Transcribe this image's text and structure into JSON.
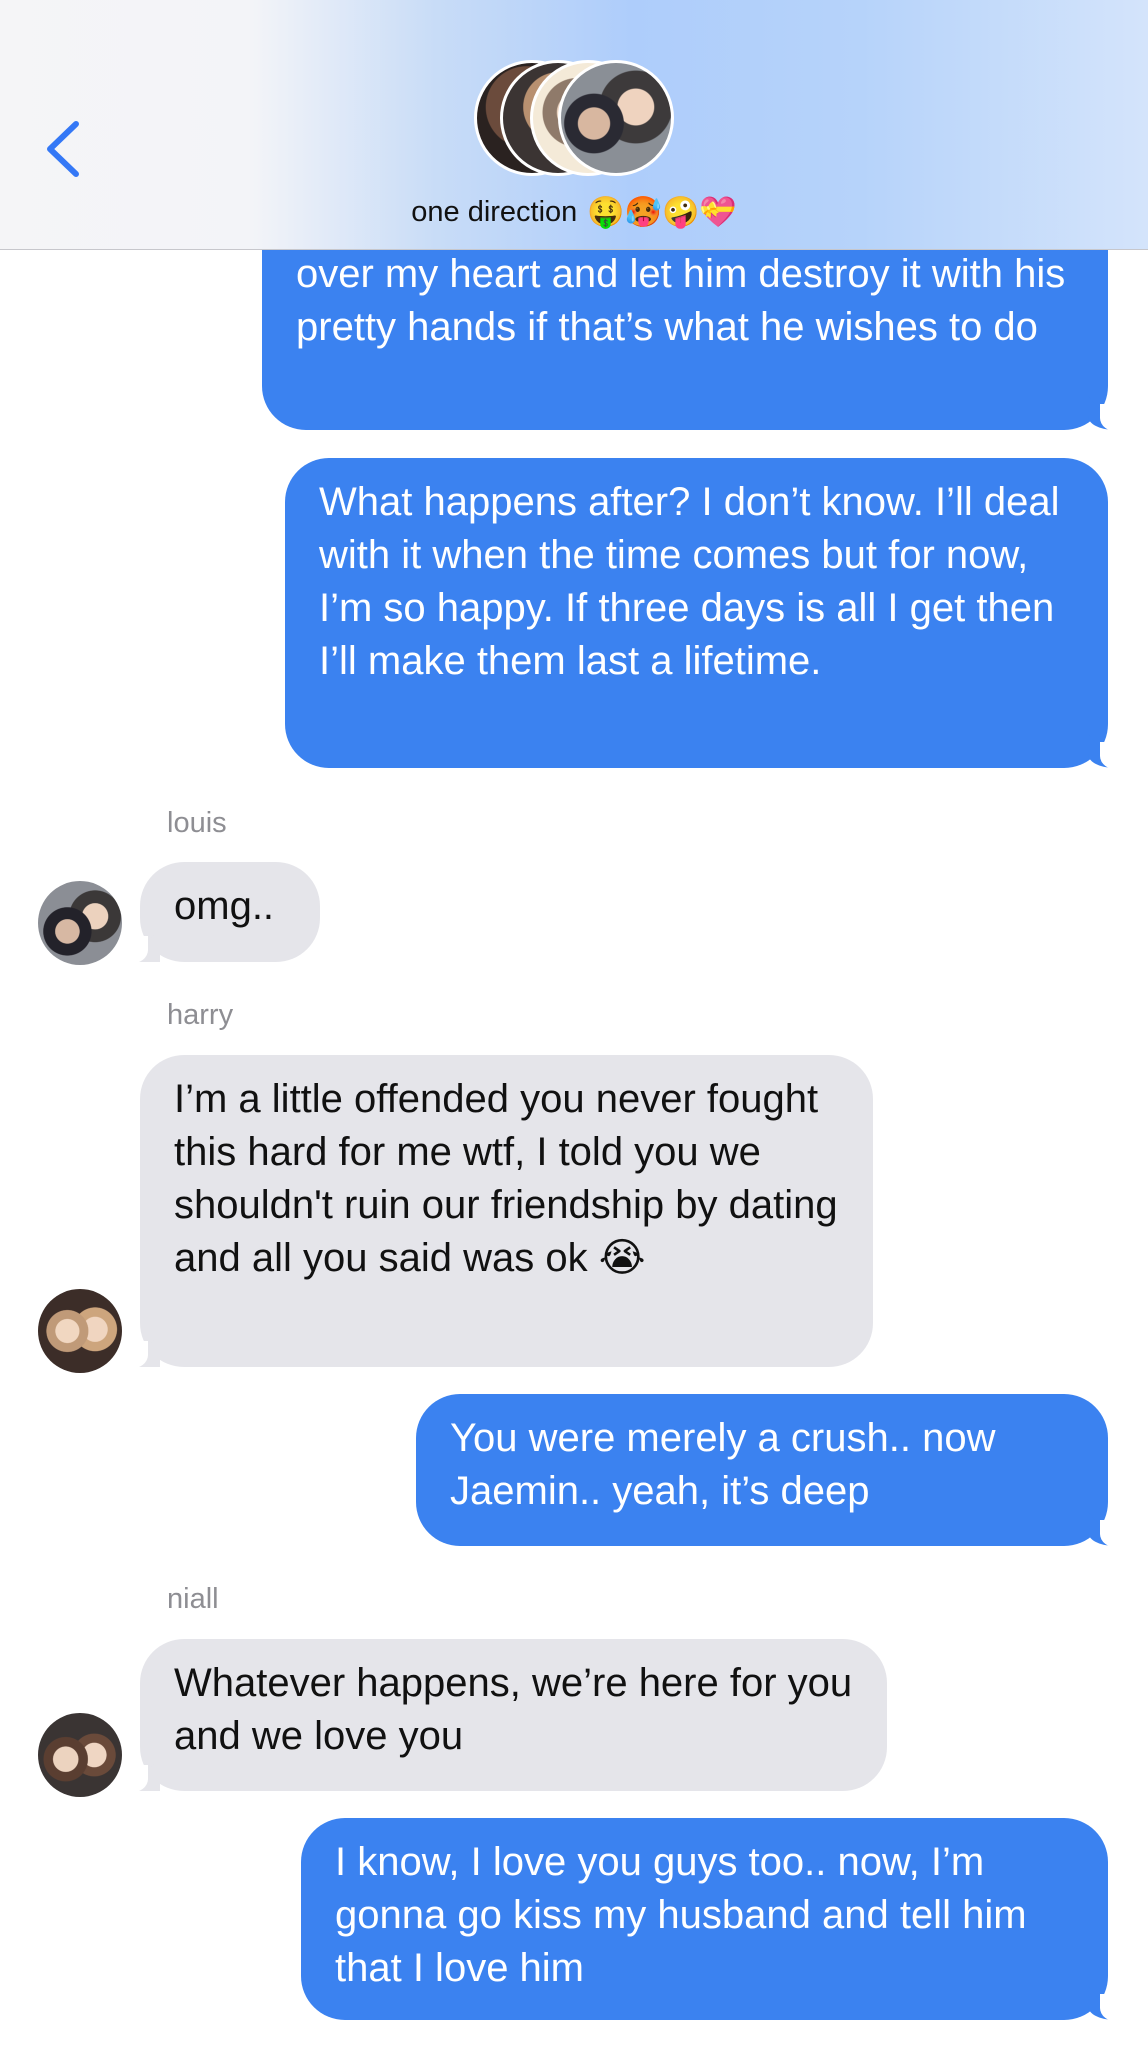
{
  "header": {
    "group_name": "one direction",
    "group_emojis": "🤑🥵🤪💝"
  },
  "messages": [
    {
      "direction": "outgoing",
      "text": "over my heart and let him destroy it with his pretty hands if that’s what he wishes to do"
    },
    {
      "direction": "outgoing",
      "text": "What happens after? I don’t know. I’ll deal with it when the time comes but for now, I’m so happy. If three days is all I get then I’ll make them last a lifetime."
    },
    {
      "direction": "incoming",
      "sender": "louis",
      "text": "omg.."
    },
    {
      "direction": "incoming",
      "sender": "harry",
      "text": "I’m a little offended you never fought this hard for me wtf, I told you we shouldn't ruin our friendship by dating and all you said was ok 😭"
    },
    {
      "direction": "outgoing",
      "text": "You were merely a crush.. now Jaemin.. yeah, it’s deep"
    },
    {
      "direction": "incoming",
      "sender": "niall",
      "text": "Whatever happens, we’re here for you and we love you"
    },
    {
      "direction": "outgoing",
      "text": "I know, I love you guys too.. now, I’m gonna go kiss my husband and tell him that I love him"
    }
  ],
  "colors": {
    "outgoing_bubble": "#3b82f0",
    "incoming_bubble": "#e5e5ea",
    "accent": "#3478f6"
  }
}
